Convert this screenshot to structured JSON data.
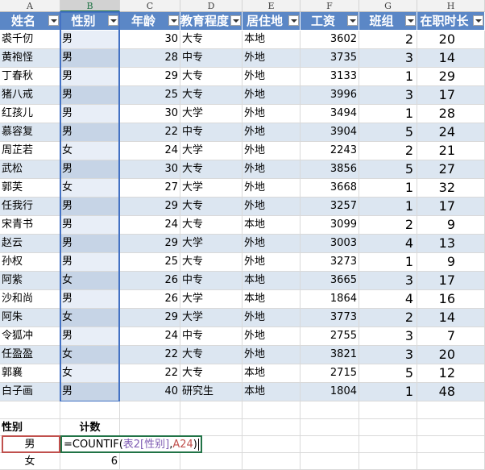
{
  "columns": [
    "A",
    "B",
    "C",
    "D",
    "E",
    "F",
    "G",
    "H"
  ],
  "headers": [
    "姓名",
    "性别",
    "年龄",
    "教育程度",
    "居住地",
    "工资",
    "班组",
    "在职时长"
  ],
  "rows": [
    [
      "裘千仞",
      "男",
      "30",
      "大专",
      "本地",
      "3602",
      "2",
      "20"
    ],
    [
      "黄袍怪",
      "男",
      "28",
      "中专",
      "外地",
      "3735",
      "3",
      "14"
    ],
    [
      "丁春秋",
      "男",
      "29",
      "大专",
      "外地",
      "3133",
      "1",
      "29"
    ],
    [
      "猪八戒",
      "男",
      "25",
      "大专",
      "外地",
      "3996",
      "3",
      "17"
    ],
    [
      "红孩儿",
      "男",
      "30",
      "大学",
      "外地",
      "3494",
      "1",
      "28"
    ],
    [
      "慕容复",
      "男",
      "22",
      "中专",
      "外地",
      "3904",
      "5",
      "24"
    ],
    [
      "周芷若",
      "女",
      "24",
      "大学",
      "外地",
      "2243",
      "2",
      "21"
    ],
    [
      "武松",
      "男",
      "30",
      "大专",
      "外地",
      "3856",
      "5",
      "27"
    ],
    [
      "郭芙",
      "女",
      "27",
      "大学",
      "外地",
      "3668",
      "1",
      "32"
    ],
    [
      "任我行",
      "男",
      "29",
      "大专",
      "外地",
      "3257",
      "1",
      "17"
    ],
    [
      "宋青书",
      "男",
      "24",
      "大专",
      "本地",
      "3099",
      "2",
      "9"
    ],
    [
      "赵云",
      "男",
      "29",
      "大学",
      "外地",
      "3003",
      "4",
      "13"
    ],
    [
      "孙权",
      "男",
      "25",
      "大专",
      "外地",
      "3273",
      "1",
      "9"
    ],
    [
      "阿紫",
      "女",
      "26",
      "中专",
      "本地",
      "3665",
      "3",
      "17"
    ],
    [
      "沙和尚",
      "男",
      "26",
      "大学",
      "本地",
      "1864",
      "4",
      "16"
    ],
    [
      "阿朱",
      "女",
      "29",
      "大学",
      "外地",
      "3773",
      "2",
      "14"
    ],
    [
      "令狐冲",
      "男",
      "24",
      "中专",
      "外地",
      "2755",
      "3",
      "7"
    ],
    [
      "任盈盈",
      "女",
      "22",
      "大专",
      "外地",
      "3821",
      "3",
      "20"
    ],
    [
      "郭襄",
      "女",
      "22",
      "大专",
      "本地",
      "2715",
      "5",
      "12"
    ],
    [
      "白子画",
      "男",
      "40",
      "研究生",
      "本地",
      "1804",
      "1",
      "48"
    ]
  ],
  "summary": {
    "header_gender": "性别",
    "header_count": "计数",
    "male": "男",
    "female": "女",
    "female_count": "6",
    "formula_prefix": "=COUNTIF(",
    "formula_ref1": "表2[性别]",
    "formula_sep": ",",
    "formula_ref2": "A24",
    "formula_suffix": ")"
  },
  "colors": {
    "header_fill": "#5b87c6",
    "band_fill": "#dce6f1",
    "selection_border": "#4472c4",
    "formula_border": "#217346",
    "male_border": "#c0504d"
  }
}
